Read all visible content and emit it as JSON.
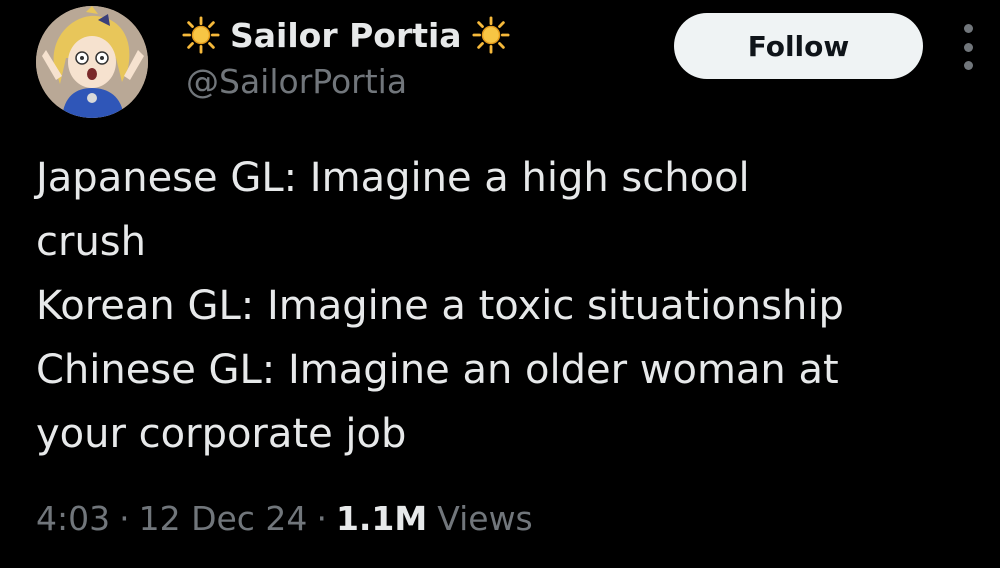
{
  "author": {
    "display_name": "Sailor Portia",
    "handle": "@SailorPortia",
    "name_emoji_left": "sun-icon",
    "name_emoji_right": "sun-icon"
  },
  "actions": {
    "follow_label": "Follow",
    "more_icon": "more-vertical-icon"
  },
  "tweet": {
    "lines": [
      "Japanese GL: Imagine a high school",
      "crush",
      "Korean GL: Imagine a toxic situationship",
      "Chinese GL: Imagine an older woman at",
      "your corporate job"
    ]
  },
  "meta": {
    "time": "4:03",
    "separator": "·",
    "date": "12 Dec 24",
    "views_count": "1.1M",
    "views_label": "Views"
  },
  "colors": {
    "background": "#000000",
    "primary_text": "#e7e9ea",
    "secondary_text": "#71767b",
    "follow_button_bg": "#eff3f4",
    "follow_button_text": "#0f1419",
    "sun": "#f6b93b"
  }
}
